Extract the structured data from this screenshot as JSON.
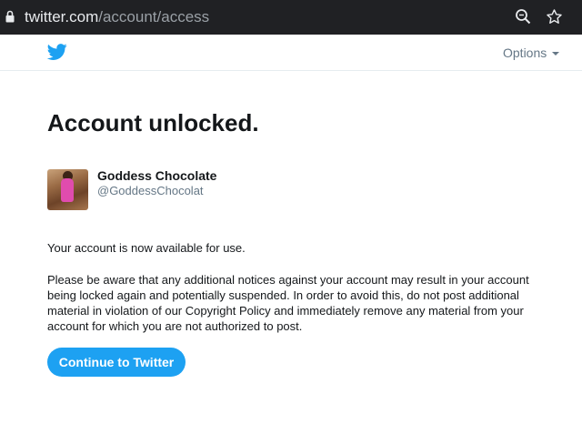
{
  "browser": {
    "url_host": "twitter.com",
    "url_path": "/account/access",
    "icons": [
      "lock-icon",
      "zoom-icon",
      "star-icon"
    ]
  },
  "header": {
    "logo_icon": "twitter-bird-icon",
    "options_label": "Options",
    "brand_color": "#1da1f2"
  },
  "main": {
    "title": "Account unlocked.",
    "user": {
      "name": "Goddess Chocolate",
      "handle": "@GoddessChocolat"
    },
    "status_text": "Your account is now available for use.",
    "notice_text": "Please be aware that any additional notices against your account may result in your account being locked again and potentially suspended. In order to avoid this, do not post additional material in violation of our Copyright Policy and immediately remove any material from your account for which you are not authorized to post.",
    "continue_label": "Continue to Twitter"
  }
}
